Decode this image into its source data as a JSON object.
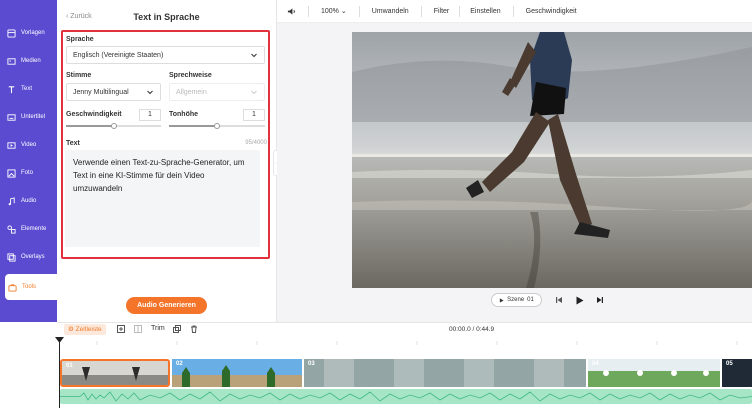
{
  "sidebar": {
    "items": [
      {
        "label": "Vorlagen",
        "icon": "template-icon"
      },
      {
        "label": "Medien",
        "icon": "media-icon"
      },
      {
        "label": "Text",
        "icon": "text-icon"
      },
      {
        "label": "Untertitel",
        "icon": "subtitle-icon"
      },
      {
        "label": "Video",
        "icon": "video-icon"
      },
      {
        "label": "Foto",
        "icon": "photo-icon"
      },
      {
        "label": "Audio",
        "icon": "audio-icon"
      },
      {
        "label": "Elemente",
        "icon": "elements-icon"
      },
      {
        "label": "Overlays",
        "icon": "overlays-icon"
      },
      {
        "label": "Tools",
        "icon": "tools-icon",
        "active": true
      }
    ]
  },
  "panel": {
    "back_label": "Zurück",
    "title": "Text in Sprache",
    "language_label": "Sprache",
    "language_value": "Englisch (Vereinigte Staaten)",
    "voice_label": "Stimme",
    "voice_value": "Jenny Multilingual",
    "style_label": "Sprechweise",
    "style_value": "Allgemein",
    "speed_label": "Geschwindigkeit",
    "speed_value": "1",
    "speed_level": 0.5,
    "pitch_label": "Tonhöhe",
    "pitch_value": "1",
    "pitch_level": 0.5,
    "text_label": "Text",
    "text_counter": "95/4000",
    "text_value": "Verwende einen Text-zu-Sprache-Generator, um Text in eine KI-Stimme für dein Video umzuwandeln",
    "generate_button": "Audio Generieren"
  },
  "toolbar": {
    "zoom": "100%",
    "convert": "Umwandeln",
    "filter": "Filter",
    "settings": "Einstellen",
    "speed": "Geschwindigkeit"
  },
  "player": {
    "scene_label": "Szene",
    "scene_number": "01"
  },
  "timeline": {
    "zeitleiste": "Zeitleiste",
    "trim": "Trim",
    "time": "00:00.0 / 0:44.9",
    "clips": [
      "01",
      "02",
      "03",
      "04",
      "05"
    ]
  },
  "colors": {
    "sidebar": "#5b4bd1",
    "accent": "#f4742a",
    "highlight_border": "#e0313c",
    "audio_track": "#a6e6c7"
  }
}
